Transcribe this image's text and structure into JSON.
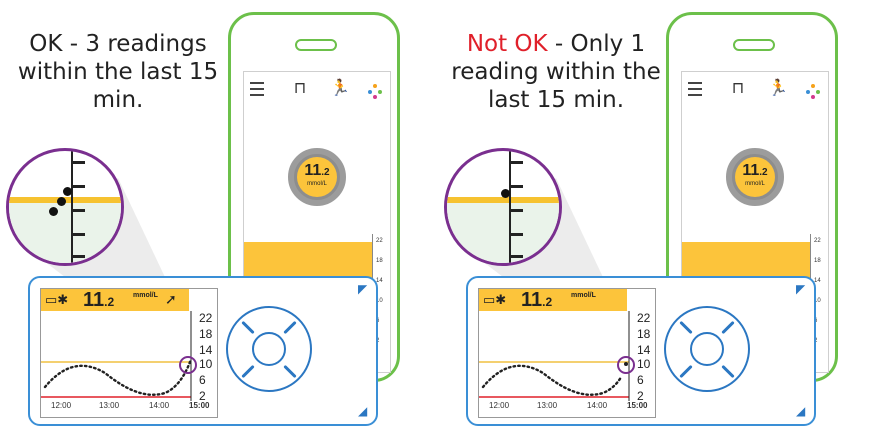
{
  "panels": [
    {
      "caption_status": "OK",
      "caption_text": " - 3 readings within the last 15 min.",
      "status_color": "#222222",
      "zoom_readings": 3
    },
    {
      "caption_status": "Not OK",
      "caption_text": " - Only 1 reading within the last 15 min.",
      "status_color": "#e0202a",
      "zoom_readings": 1
    }
  ],
  "phone": {
    "reading_value": "11",
    "reading_decimal": ".2",
    "reading_unit": "mmol/L",
    "y_ticks": [
      "22",
      "18",
      "14",
      "10",
      "6",
      "2"
    ]
  },
  "receiver": {
    "value_int": "11",
    "value_dec": ".2",
    "unit": "mmol/L",
    "y_ticks": [
      "22",
      "18",
      "14",
      "10",
      "6",
      "2"
    ],
    "x_ticks": [
      "12:00",
      "13:00",
      "14:00",
      "15:00"
    ]
  },
  "colors": {
    "accent_green": "#6cc04a",
    "glucose_yellow": "#fcc43b",
    "device_blue": "#2b77c2",
    "zoom_purple": "#7a2f8f",
    "warning_red": "#e0202a"
  }
}
